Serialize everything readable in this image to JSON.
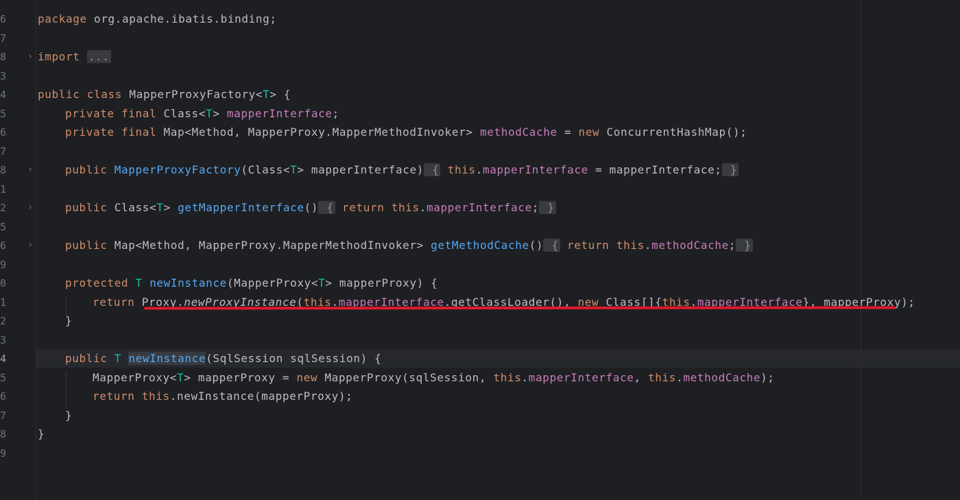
{
  "editor": {
    "line_numbers": [
      "6",
      "7",
      "8",
      "3",
      "4",
      "5",
      "6",
      "7",
      "8",
      "1",
      "2",
      "5",
      "6",
      "9",
      "0",
      "1",
      "2",
      "3",
      "4",
      "5",
      "6",
      "7",
      "8",
      "9"
    ],
    "current_line": "4",
    "lines": {
      "l_package": {
        "kw": "package",
        "rest": " org.apache.ibatis.binding;"
      },
      "l_import": {
        "kw": "import",
        "fold": "..."
      },
      "l_class": {
        "kw1": "public",
        "kw2": "class",
        "name": " MapperProxyFactory<",
        "t": "T",
        "end": "> {"
      },
      "l_field1": {
        "kw": "private final",
        "type": " Class<",
        "t": "T",
        "close": "> ",
        "field": "mapperInterface",
        "end": ";"
      },
      "l_field2": {
        "kw": "private final",
        "type": " Map<Method, MapperProxy.MapperMethodInvoker> ",
        "field": "methodCache",
        "eq": " = ",
        "new": "new",
        "end": " ConcurrentHashMap();"
      },
      "l_ctor": {
        "kw": "public",
        "name": "MapperProxyFactory",
        "p1": "(Class<",
        "t": "T",
        "p2": "> mapperInterface)",
        "ob": " {",
        "this": "this",
        "dot": ".",
        "field": "mapperInterface",
        "end": " = mapperInterface;",
        "cb": " }"
      },
      "l_getMI": {
        "kw": "public",
        "type": " Class<",
        "t": "T",
        "close": "> ",
        "name": "getMapperInterface",
        "paren": "()",
        "ob": " {",
        "ret": "return",
        "this": "this",
        "dot": ".",
        "field": "mapperInterface",
        "semi": ";",
        "cb": " }"
      },
      "l_getMC": {
        "kw": "public",
        "type": " Map<Method, MapperProxy.MapperMethodInvoker> ",
        "name": "getMethodCache",
        "paren": "()",
        "ob": " {",
        "ret": "return",
        "this": "this",
        "dot": ".",
        "field": "methodCache",
        "semi": ";",
        "cb": " }"
      },
      "l_newInst1": {
        "kw": "protected",
        "t": "T",
        "name": "newInstance",
        "end": "(MapperProxy<",
        "t2": "T",
        "end2": "> mapperProxy) {"
      },
      "l_return1": {
        "ret": "return",
        "proxy": " Proxy.",
        "npi": "newProxyInstance",
        "open": "(",
        "this1": "this",
        "dot1": ".",
        "field1": "mapperInterface",
        "gcl": ".getClassLoader(), ",
        "new": "new",
        "cls": " Class[]{",
        "this2": "this",
        "dot2": ".",
        "field2": "mapperInterface",
        "end": "}, mapperProxy);"
      },
      "l_close1": {
        "text": "}"
      },
      "l_newInst2": {
        "kw": "public",
        "t": "T",
        "name": "newInstance",
        "end": "(SqlSession sqlSession) {"
      },
      "l_mp": {
        "type": "MapperProxy<",
        "t": "T",
        "mid": "> mapperProxy = ",
        "new": "new",
        "ctor": " MapperProxy(sqlSession, ",
        "this1": "this",
        "dot1": ".",
        "field1": "mapperInterface",
        "comma": ", ",
        "this2": "this",
        "dot2": ".",
        "field2": "methodCache",
        "end": ");"
      },
      "l_return2": {
        "ret": "return",
        "this": " this",
        "end": ".newInstance(mapperProxy);"
      },
      "l_close2": {
        "text": "}"
      },
      "l_close3": {
        "text": "}"
      }
    }
  },
  "colors": {
    "background": "#1e1f22",
    "keyword": "#cf8e6d",
    "type_param": "#16baac",
    "field": "#c77dbb",
    "method": "#56a8f5",
    "annotation_underline": "#e01a2c"
  }
}
